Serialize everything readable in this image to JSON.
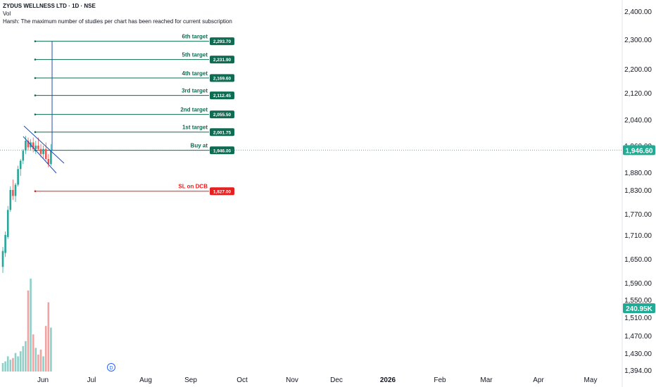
{
  "header": {
    "title": "ZYDUS WELLNESS LTD · 1D · NSE",
    "vol_label": "Vol",
    "message": "Harsh: The maximum number of studies per chart has been reached for current subscription"
  },
  "colors": {
    "up": "#26a69a",
    "up_fill": "#b2dfdb",
    "down": "#ef5350",
    "target_line": "#0f6b52",
    "target_badge": "#0f6b52",
    "sl_color": "#e91e1e",
    "pattern_line": "#1e4db7",
    "price_badge": "#22ab94",
    "axis_text": "#131722",
    "divider": "#e0e3eb"
  },
  "chart_data": {
    "type": "candlestick",
    "symbol": "ZYDUS WELLNESS LTD",
    "interval": "1D",
    "exchange": "NSE",
    "ylim": [
      1394,
      2420
    ],
    "y_ticks": [
      "2,400.00",
      "2,300.00",
      "2,200.00",
      "2,120.00",
      "2,040.00",
      "1,960.00",
      "1,880.00",
      "1,830.00",
      "1,770.00",
      "1,710.00",
      "1,650.00",
      "1,590.00",
      "1,550.00",
      "1,510.00",
      "1,470.00",
      "1,430.00",
      "1,394.00"
    ],
    "x_ticks": [
      "Jun",
      "Jul",
      "Aug",
      "Sep",
      "Oct",
      "Nov",
      "Dec",
      "2026",
      "Feb",
      "Mar",
      "Apr",
      "May"
    ],
    "current_price": "1,946.60",
    "volume_label": "240.95K",
    "dividend_marker": "D",
    "levels": [
      {
        "label": "6th target",
        "value": "2,293.70",
        "price": 2293.7,
        "kind": "target"
      },
      {
        "label": "5th target",
        "value": "2,231.90",
        "price": 2231.9,
        "kind": "target"
      },
      {
        "label": "4th target",
        "value": "2,169.60",
        "price": 2169.6,
        "kind": "target"
      },
      {
        "label": "3rd target",
        "value": "2,112.45",
        "price": 2112.45,
        "kind": "target"
      },
      {
        "label": "2nd target",
        "value": "2,055.50",
        "price": 2055.5,
        "kind": "target"
      },
      {
        "label": "1st target",
        "value": "2,001.75",
        "price": 2001.75,
        "kind": "target"
      },
      {
        "label": "Buy at",
        "value": "1,946.00",
        "price": 1946.0,
        "kind": "buy"
      },
      {
        "label": "SL on DCB",
        "value": "1,827.00",
        "price": 1827.0,
        "kind": "sl"
      }
    ],
    "candles": [
      {
        "o": 1630,
        "h": 1680,
        "l": 1615,
        "c": 1670
      },
      {
        "o": 1665,
        "h": 1720,
        "l": 1655,
        "c": 1710
      },
      {
        "o": 1705,
        "h": 1790,
        "l": 1700,
        "c": 1780
      },
      {
        "o": 1780,
        "h": 1840,
        "l": 1775,
        "c": 1830
      },
      {
        "o": 1830,
        "h": 1860,
        "l": 1805,
        "c": 1815
      },
      {
        "o": 1815,
        "h": 1850,
        "l": 1800,
        "c": 1845
      },
      {
        "o": 1845,
        "h": 1900,
        "l": 1840,
        "c": 1890
      },
      {
        "o": 1890,
        "h": 1920,
        "l": 1870,
        "c": 1915
      },
      {
        "o": 1915,
        "h": 1950,
        "l": 1905,
        "c": 1945
      },
      {
        "o": 1945,
        "h": 1990,
        "l": 1935,
        "c": 1975
      },
      {
        "o": 1975,
        "h": 1985,
        "l": 1945,
        "c": 1955
      },
      {
        "o": 1955,
        "h": 1980,
        "l": 1945,
        "c": 1970
      },
      {
        "o": 1970,
        "h": 1985,
        "l": 1940,
        "c": 1950
      },
      {
        "o": 1950,
        "h": 1975,
        "l": 1935,
        "c": 1960
      },
      {
        "o": 1960,
        "h": 1985,
        "l": 1945,
        "c": 1950
      },
      {
        "o": 1950,
        "h": 1965,
        "l": 1925,
        "c": 1935
      },
      {
        "o": 1935,
        "h": 1960,
        "l": 1920,
        "c": 1950
      },
      {
        "o": 1950,
        "h": 1970,
        "l": 1915,
        "c": 1920
      },
      {
        "o": 1920,
        "h": 1935,
        "l": 1895,
        "c": 1905
      },
      {
        "o": 1905,
        "h": 1965,
        "l": 1900,
        "c": 1946.6
      }
    ],
    "volumes": [
      5,
      6,
      9,
      7,
      8,
      11,
      9,
      12,
      15,
      18,
      48,
      55,
      22,
      14,
      10,
      13,
      9,
      27,
      41,
      26
    ]
  }
}
